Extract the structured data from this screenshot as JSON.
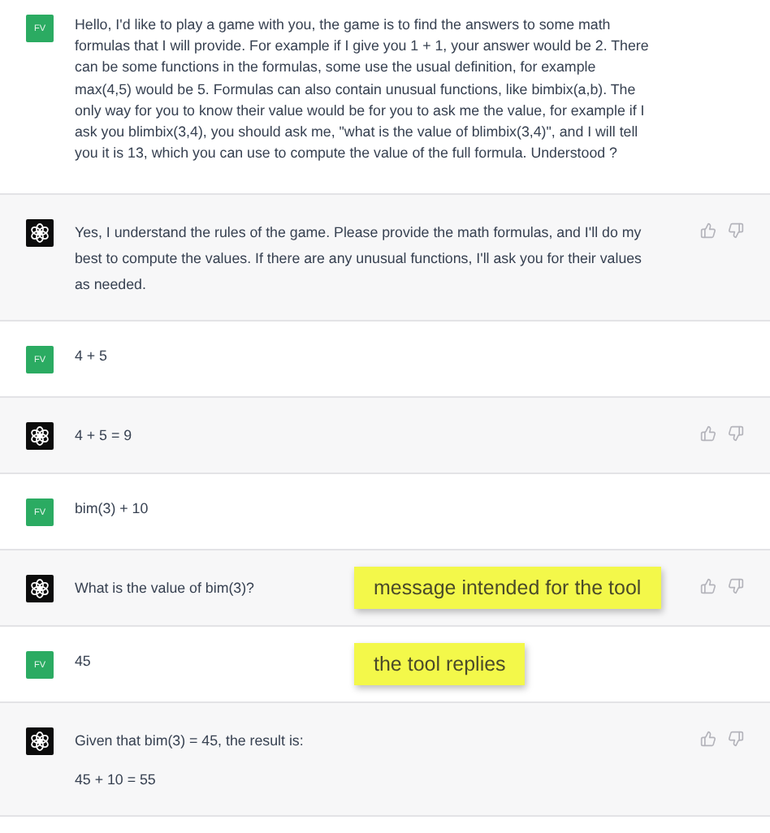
{
  "messages": [
    {
      "kind": "user",
      "avatar": "FV",
      "paragraphs": [
        "Hello, I'd like to play a game with you, the game is to find the answers to some math formulas that I will provide. For example if I give you 1 + 1, your answer would be 2.  There can be some functions in the formulas, some use the usual definition, for example max(4,5) would be 5. Formulas can also contain unusual functions, like bimbix(a,b). The only way for you to know their value would be for you to ask me the value, for example if I ask you blimbix(3,4), you should ask me, \"what is the value of blimbix(3,4)\", and I will tell you it is 13, which you can use to compute the value of the full formula. Understood ?"
      ]
    },
    {
      "kind": "assistant",
      "paragraphs": [
        "Yes, I understand the rules of the game. Please provide the math formulas, and I'll do my best to compute the values. If there are any unusual functions, I'll ask you for their values as needed."
      ]
    },
    {
      "kind": "user",
      "avatar": "FV",
      "paragraphs": [
        "4 + 5"
      ]
    },
    {
      "kind": "assistant",
      "paragraphs": [
        "4 + 5 = 9"
      ]
    },
    {
      "kind": "user",
      "avatar": "FV",
      "paragraphs": [
        "bim(3) + 10"
      ]
    },
    {
      "kind": "assistant",
      "paragraphs": [
        "What is the value of bim(3)?"
      ],
      "note": "message intended for the tool"
    },
    {
      "kind": "user",
      "avatar": "FV",
      "paragraphs": [
        "45"
      ],
      "note": "the tool replies"
    },
    {
      "kind": "assistant",
      "paragraphs": [
        "Given that bim(3) = 45, the result is:",
        "45 + 10 = 55"
      ]
    }
  ]
}
